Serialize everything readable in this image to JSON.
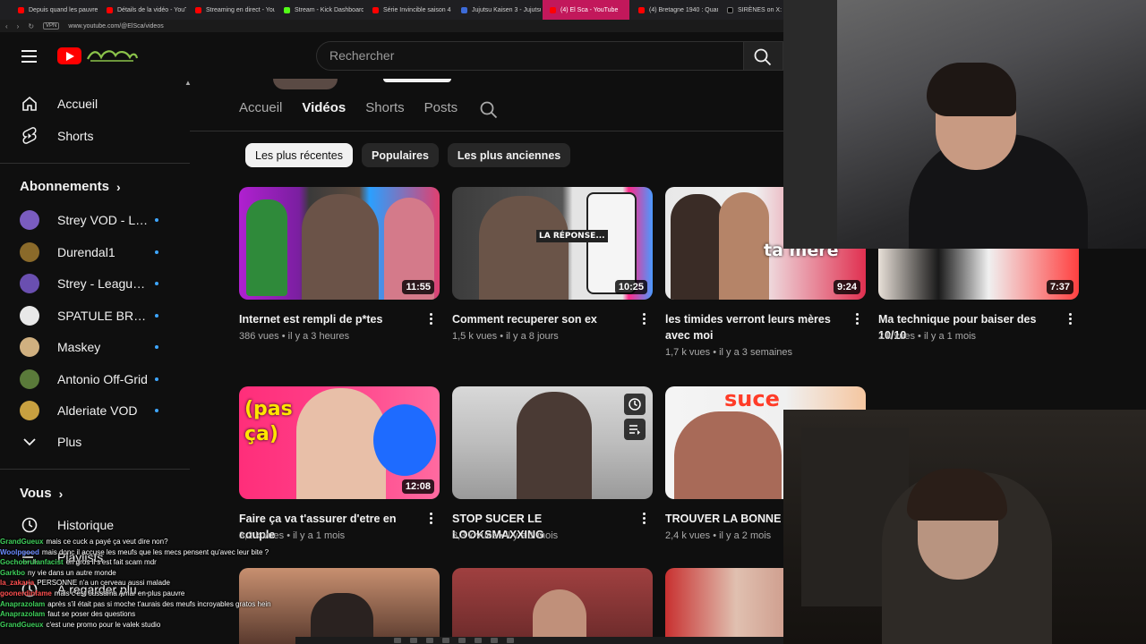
{
  "browser": {
    "tabs": [
      {
        "label": "Depuis quand les pauvres",
        "icon": "youtube-icon"
      },
      {
        "label": "Détails de la vidéo - YouT",
        "icon": "youtube-icon"
      },
      {
        "label": "Streaming en direct - You",
        "icon": "youtube-icon"
      },
      {
        "label": "Stream - Kick Dashboard",
        "icon": "kick-icon"
      },
      {
        "label": "Série Invincible saison 4",
        "icon": "youtube-icon"
      },
      {
        "label": "Jujutsu Kaisen 3 - Jujutsu",
        "icon": "site-icon"
      },
      {
        "label": "(4) El Sca - YouTube",
        "icon": "youtube-icon",
        "active": true
      },
      {
        "label": "(4) Bretagne 1940 : Quand",
        "icon": "youtube-icon"
      },
      {
        "label": "SIRÈNES on X: \"",
        "icon": "x-icon"
      }
    ],
    "url": "www.youtube.com/@ElSca/videos"
  },
  "header": {
    "search_placeholder": "Rechercher"
  },
  "sidebar": {
    "main": [
      {
        "label": "Accueil",
        "icon": "home-icon"
      },
      {
        "label": "Shorts",
        "icon": "shorts-icon"
      }
    ],
    "subscriptions_heading": "Abonnements",
    "subscriptions": [
      {
        "label": "Strey VOD - League of…",
        "color": "#7a5cc0"
      },
      {
        "label": "Durendal1",
        "color": "#8a6a2a"
      },
      {
        "label": "Strey - League of…",
        "color": "#6a4fb0"
      },
      {
        "label": "SPATULE BROS",
        "color": "#e8e8e8"
      },
      {
        "label": "Maskey",
        "color": "#d0b080"
      },
      {
        "label": "Antonio Off-Grid",
        "color": "#5a7a3a"
      },
      {
        "label": "Alderiate VOD",
        "color": "#c8a040"
      }
    ],
    "more_label": "Plus",
    "you_heading": "Vous",
    "you_items": [
      {
        "label": "Historique",
        "icon": "history-icon"
      },
      {
        "label": "Playlists",
        "icon": "playlist-icon"
      },
      {
        "label": "À regarder plus tard",
        "icon": "watch-later-icon"
      }
    ]
  },
  "channel": {
    "tabs": [
      "Accueil",
      "Vidéos",
      "Shorts",
      "Posts"
    ],
    "active_tab": "Vidéos",
    "chips": [
      "Les plus récentes",
      "Populaires",
      "Les plus anciennes"
    ],
    "active_chip": "Les plus récentes"
  },
  "videos": [
    {
      "title": "Internet est rempli de p*tes",
      "views": "386 vues",
      "age": "il y a 3 heures",
      "duration": "11:55"
    },
    {
      "title": "Comment recuperer son ex",
      "views": "1,5 k vues",
      "age": "il y a 8 jours",
      "duration": "10:25"
    },
    {
      "title": "les timides verront leurs mères avec moi",
      "views": "1,7 k vues",
      "age": "il y a 3 semaines",
      "duration": "9:24"
    },
    {
      "title": "Ma technique pour baiser des 10/10",
      "views": "2 k vues",
      "age": "il y a 1 mois",
      "duration": "7:37"
    },
    {
      "title": "Faire ça va t'assurer d'etre en couple",
      "views": "3,2 k vues",
      "age": "il y a 1 mois",
      "duration": "12:08"
    },
    {
      "title": "STOP SUCER LE LOOKSMAXXING",
      "views": "3,3 k vues",
      "age": "il y a 1 mois",
      "duration": ""
    },
    {
      "title": "TROUVER LA BONNE PA",
      "views": "2,4 k vues",
      "age": "il y a 2 mois",
      "duration": ""
    }
  ],
  "thumb_text": {
    "v2": "LA RÉPONSE...",
    "v3": "ta mere",
    "v5": "(pas ça)",
    "v7": "suce"
  },
  "chat": [
    {
      "user": "GrandGueux",
      "color": "#3ecf5a",
      "text": "mais ce cuck a payé ça veut dire non?"
    },
    {
      "user": "Woolpgood",
      "color": "#6a8aff",
      "text": "mais donc il accuse les meufs que les mecs pensent qu'avec leur bite ?"
    },
    {
      "user": "Gochobrulanfacist",
      "color": "#3ecf5a",
      "text": "en gros il s'est fait scam mdr"
    },
    {
      "user": "Garkbo",
      "color": "#3ecf5a",
      "text": "ny vie dans un autre monde"
    },
    {
      "user": "la_zakaria",
      "color": "#ff5050",
      "text": "PERSONNE n'a un cerveau aussi malade"
    },
    {
      "user": "goonerdinfame",
      "color": "#ff5050",
      "text": "mais c'est oussama Amar en plus pauvre"
    },
    {
      "user": "Anaprazolam",
      "color": "#3ecf5a",
      "text": "après s'il était pas si moche t'aurais des meufs incroyables gratos hein"
    },
    {
      "user": "Anaprazolam",
      "color": "#3ecf5a",
      "text": "faut se poser des questions"
    },
    {
      "user": "GrandGueux",
      "color": "#3ecf5a",
      "text": "c'est une promo pour le valek studio"
    }
  ]
}
